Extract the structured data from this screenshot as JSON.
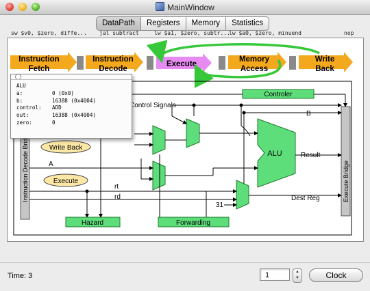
{
  "window": {
    "title": "MainWindow"
  },
  "tabs": [
    "DataPath",
    "Registers",
    "Memory",
    "Statistics"
  ],
  "stage_instructions": [
    "sw $v0, $zero, diffe...",
    "jal subtract",
    "lw $a1, $zero, subtr...",
    "lw $a0, $zero, minuend",
    "nop"
  ],
  "pipeline": {
    "stages": [
      "Instruction Fetch",
      "Instruction Decode",
      "Execute",
      "Memory Access",
      "Write Back"
    ],
    "lines": [
      [
        "Instruction",
        "Fetch"
      ],
      [
        "Instruction",
        "Decode"
      ],
      [
        "Execute"
      ],
      [
        "Memory",
        "Access"
      ],
      [
        "Write",
        "Back"
      ]
    ],
    "active_stage": "Execute",
    "colors": {
      "arrow": "#f4a81d",
      "active": "#e78af2",
      "feedback": "#37c83a",
      "block": "#8a8a8a"
    }
  },
  "datapath": {
    "left_bridge": "Instruction Decode Bridge",
    "right_bridge": "Execute Bridge",
    "controller": "Controler",
    "control_signals": "Control Signals",
    "alu": "ALU",
    "result": "Result",
    "dest_reg": "Dest Reg",
    "hazard": "Hazard",
    "forwarding": "Forwarding",
    "write_back_bubble": "Write Back",
    "execute_bubble": "Execute",
    "wire_a": "A",
    "wire_b": "B",
    "wire_rt": "rt",
    "wire_rd": "rd",
    "const_31": "31",
    "green": "#5ede7a"
  },
  "popup": {
    "title": "ALU",
    "rows": [
      {
        "key": "a:",
        "value": "0 (0x0)"
      },
      {
        "key": "b:",
        "value": "16388 (0x4004)"
      },
      {
        "key": "control:",
        "value": "ADD"
      },
      {
        "key": "out:",
        "value": "16388 (0x4004)"
      },
      {
        "key": "zero:",
        "value": "0"
      }
    ]
  },
  "bottom": {
    "time_label": "Time: 3",
    "stepper_value": "1",
    "clock_label": "Clock"
  }
}
